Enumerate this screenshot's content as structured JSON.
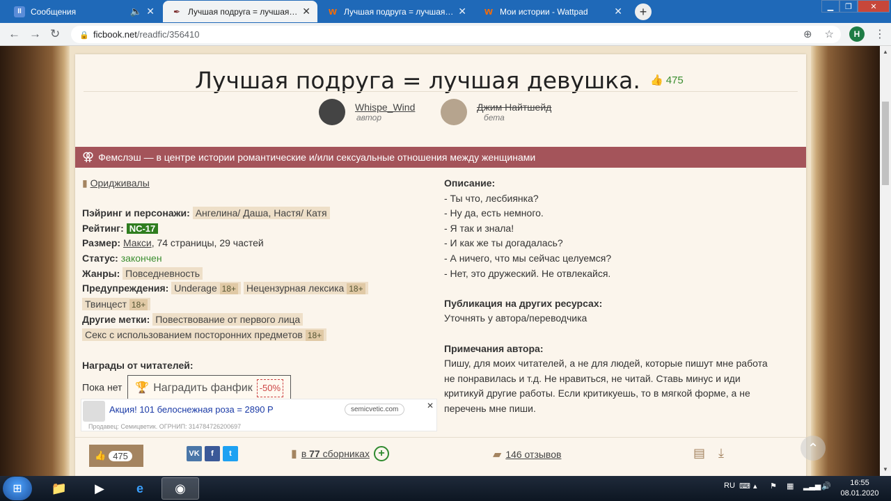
{
  "browser": {
    "tabs": [
      {
        "title": "Сообщения",
        "favicon": "messages-icon",
        "active": false
      },
      {
        "title": "Лучшая подруга = лучшая девушка.",
        "favicon": "ficbook-icon",
        "active": true
      },
      {
        "title": "Лучшая подруга = лучшая девушка.",
        "favicon": "wattpad-icon",
        "active": false
      },
      {
        "title": "Мои истории - Wattpad",
        "favicon": "wattpad-icon",
        "active": false
      }
    ],
    "url_host": "ficbook.net",
    "url_path": "/readfic/356410",
    "profile_initial": "H"
  },
  "fic": {
    "title": "Лучшая подруга = лучшая девушка.",
    "likes": "475",
    "author": {
      "name": "Whispe_Wind",
      "role": "автор"
    },
    "beta": {
      "name": "Джим Найтшейд",
      "role": "бета"
    },
    "direction_banner": "Фемслэш — в центре истории романтические и/или сексуальные отношения между женщинами",
    "fandom": "Оридживалы",
    "pairing_label": "Пэйринг и персонажи:",
    "pairing_value": "Ангелина/ Даша, Настя/ Катя",
    "rating_label": "Рейтинг:",
    "rating_value": "NC-17",
    "size_label": "Размер:",
    "size_link": "Макси",
    "size_rest": ", 74 страницы, 29 частей",
    "status_label": "Статус:",
    "status_value": "закончен",
    "genres_label": "Жанры:",
    "genres_value": "Повседневность",
    "warnings_label": "Предупреждения:",
    "warnings": [
      {
        "name": "Underage",
        "age": "18+"
      },
      {
        "name": "Нецензурная лексика",
        "age": "18+"
      },
      {
        "name": "Твинцест",
        "age": "18+"
      }
    ],
    "tags_label": "Другие метки:",
    "tags": [
      {
        "name": "Повествование от первого лица",
        "age": ""
      },
      {
        "name": "Секс с использованием посторонних предметов",
        "age": "18+"
      }
    ],
    "awards_label": "Награды от читателей:",
    "awards_none": "Пока нет",
    "award_button": "Наградить фанфик",
    "award_discount": "-50%",
    "description_label": "Описание:",
    "description": [
      "- Ты что, лесбиянка?",
      "- Ну да, есть немного.",
      "- Я так и знала!",
      "- И как же ты догадалась?",
      "- А ничего, что мы сейчас целуемся?",
      "- Нет, это дружеский. Не отвлекайся."
    ],
    "publication_label": "Публикация на других ресурсах:",
    "publication_value": "Уточнять у автора/переводчика",
    "notes_label": "Примечания автора:",
    "notes_lines": [
      "Пишу, для моих читателей, а не для людей, которые пишут мне работа",
      "не понравилась и т.д. Не нравиться, не читай. Ставь минус и иди",
      "критикуй другие работы. Если критикуешь, то в мягкой форме, а не",
      "перечень мне пиши."
    ]
  },
  "ad": {
    "text": "Акция! 101 белоснежная роза = 2890 Р",
    "domain": "semicvetic.com",
    "seller": "Продавец: Семицветик. ОГРНИП: 314784726200697"
  },
  "bottom": {
    "likes": "475",
    "collections_prefix": "в ",
    "collections_count": "77",
    "collections_suffix": " сборниках",
    "reviews": "146 отзывов",
    "social": [
      "VK",
      "f",
      "t"
    ]
  },
  "taskbar": {
    "lang": "RU",
    "time": "16:55",
    "date": "08.01.2020"
  }
}
